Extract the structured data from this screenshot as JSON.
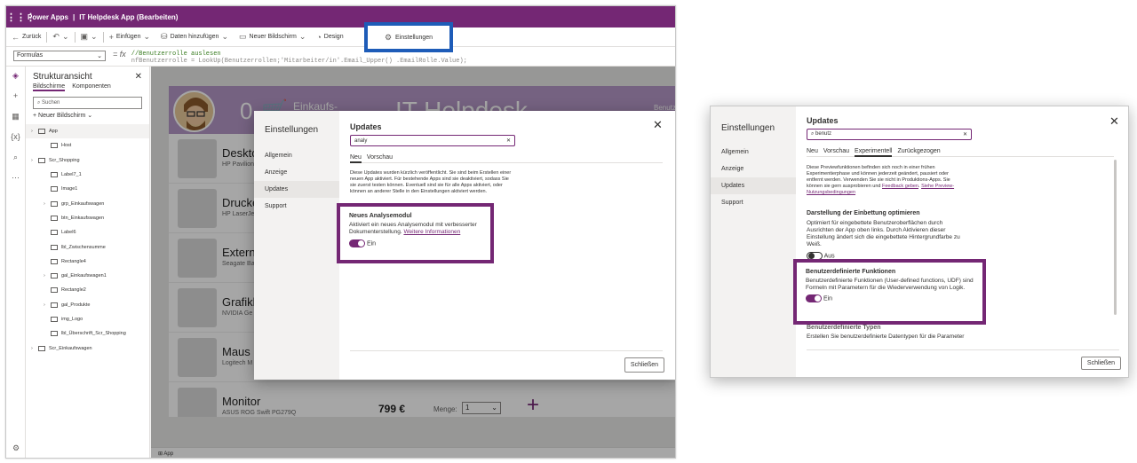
{
  "app": {
    "product": "Power Apps",
    "title": "IT Helpdesk App (Bearbeiten)"
  },
  "toolbar": {
    "back": "Zurück",
    "insert": "Einfügen",
    "add_data": "Daten hinzufügen",
    "new_screen": "Neuer Bildschirm",
    "design": "Design",
    "settings": "Einstellungen"
  },
  "formula": {
    "property": "Formulas",
    "line1": "//Benutzerrolle auslesen",
    "line2": "nfBenutzerrolle = LookUp(Benutzerrollen;'Mitarbeiter/in'.Email_Upper() .EmailRolle.Value);"
  },
  "tree": {
    "title": "Strukturansicht",
    "tab_screens": "Bildschirme",
    "tab_components": "Komponenten",
    "search_placeholder": "Suchen",
    "new_screen": "Neuer Bildschirm",
    "items": [
      "App",
      "Host",
      "Scr_Shopping",
      "Label7_1",
      "Image1",
      "grp_Einkaufswagen",
      "btn_Einkaufswagen",
      "Label6",
      "lbl_Zwischensumme",
      "Rectangle4",
      "gal_Einkaufswagen1",
      "Rectangle2",
      "gal_Produkte",
      "img_Logo",
      "lbl_Überschrift_Scr_Shopping",
      "Scr_Einkaufswagen"
    ]
  },
  "statusbar": {
    "screen": "App"
  },
  "canvas": {
    "cart_count": "0",
    "cart_label": "Einkaufs-",
    "app_title": "IT Helpdesk",
    "user": "Benutzer",
    "products": [
      {
        "name": "Desktop",
        "sub": "HP Pavilion"
      },
      {
        "name": "Drucker",
        "sub": "HP LaserJet"
      },
      {
        "name": "Externe",
        "sub": "Seagate Ba"
      },
      {
        "name": "Grafikkarte",
        "sub": "NVIDIA Ge"
      },
      {
        "name": "Maus",
        "sub": "Logitech M"
      },
      {
        "name": "Monitor",
        "sub": "ASUS ROG Swift PG279Q"
      }
    ],
    "price": "799 €",
    "qty_label": "Menge:",
    "qty_value": "1"
  },
  "dialog1": {
    "heading": "Einstellungen",
    "nav": [
      "Allgemein",
      "Anzeige",
      "Updates",
      "Support"
    ],
    "section": "Updates",
    "search_value": "analy",
    "tab_new": "Neu",
    "tab_preview": "Vorschau",
    "intro": "Diese Updates wurden kürzlich veröffentlicht. Sie sind beim Erstellen einer neuen App aktiviert. Für bestehende Apps sind sie deaktiviert, sodass Sie sie zuerst testen können. Eventuell sind sie für alle Apps aktiviert, oder können an anderer Stelle in den Einstellungen aktiviert werden.",
    "feature_title": "Neues Analysemodul",
    "feature_desc": "Aktiviert ein neues Analysemodul mit verbesserter Dokumenterstellung.",
    "feature_link": "Weitere Informationen",
    "toggle_label": "Ein",
    "close": "Schließen"
  },
  "dialog2": {
    "heading": "Einstellungen",
    "nav": [
      "Allgemein",
      "Anzeige",
      "Updates",
      "Support"
    ],
    "section": "Updates",
    "search_value": "benutz",
    "tabs": [
      "Neu",
      "Vorschau",
      "Experimentell",
      "Zurückgezogen"
    ],
    "intro": "Diese Previewfunktionen befinden sich noch in einer frühen Experimentierphase und können jederzeit geändert, pausiert oder entfernt werden. Verwenden Sie sie nicht in Produktions-Apps. Sie können sie gern ausprobieren und",
    "intro_link": "Feedback geben",
    "intro_link2": "Siehe Preview-Nutzungsbedingungen",
    "f1_title": "Darstellung der Einbettung optimieren",
    "f1_desc": "Optimiert für eingebettete Benutzeroberflächen durch Ausrichten der App oben links. Durch Aktivieren dieser Einstellung ändert sich die eingebettete Hintergrundfarbe zu Weiß.",
    "f1_toggle": "Aus",
    "f2_title": "Benutzerdefinierte Funktionen",
    "f2_desc": "Benutzerdefinierte Funktionen (User-defined functions, UDF) sind Formeln mit Parametern für die Wiederverwendung von Logik.",
    "f2_toggle": "Ein",
    "f3_title": "Benutzerdefinierte Typen",
    "f3_desc": "Erstellen Sie benutzerdefinierte Datentypen für die Parameter",
    "close": "Schließen"
  },
  "colors": {
    "brand": "#742774",
    "highlight": "#1e5cb8"
  }
}
